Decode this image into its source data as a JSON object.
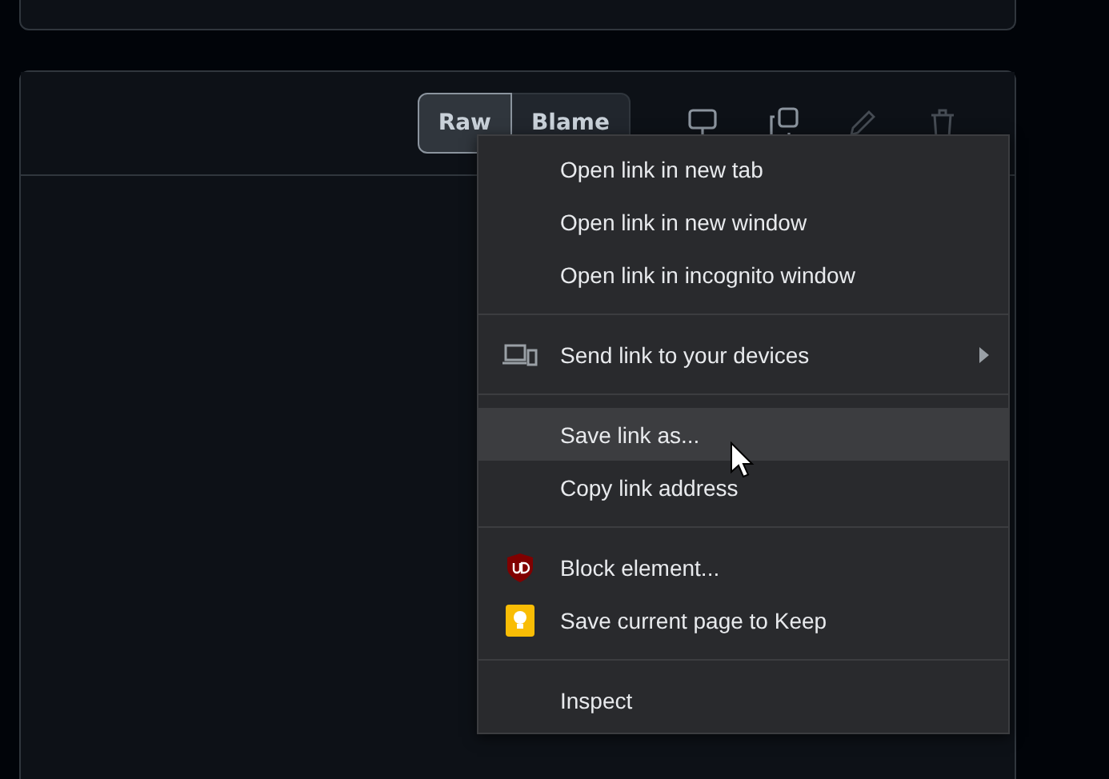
{
  "toolbar": {
    "buttons": [
      {
        "label": "Raw",
        "selected": true
      },
      {
        "label": "Blame",
        "selected": false
      }
    ],
    "icons": [
      {
        "kind": "display",
        "disabled": false
      },
      {
        "kind": "copy",
        "disabled": false
      },
      {
        "kind": "pencil",
        "disabled": true
      },
      {
        "kind": "trash",
        "disabled": true
      }
    ]
  },
  "context_menu": {
    "items": [
      {
        "kind": "plain",
        "label": "Open link in new tab",
        "submenu": false,
        "hovered": false
      },
      {
        "kind": "plain",
        "label": "Open link in new window",
        "submenu": false,
        "hovered": false
      },
      {
        "kind": "plain",
        "label": "Open link in incognito window",
        "submenu": false,
        "hovered": false
      },
      {
        "kind": "separator"
      },
      {
        "kind": "devices",
        "label": "Send link to your devices",
        "submenu": true,
        "hovered": false
      },
      {
        "kind": "separator"
      },
      {
        "kind": "plain",
        "label": "Save link as...",
        "submenu": false,
        "hovered": true
      },
      {
        "kind": "plain",
        "label": "Copy link address",
        "submenu": false,
        "hovered": false
      },
      {
        "kind": "separator"
      },
      {
        "kind": "shield",
        "label": "Block element...",
        "submenu": false,
        "hovered": false
      },
      {
        "kind": "bulb",
        "label": "Save current page to Keep",
        "submenu": false,
        "hovered": false
      },
      {
        "kind": "separator"
      },
      {
        "kind": "plain",
        "label": "Inspect",
        "submenu": false,
        "hovered": false
      }
    ]
  }
}
